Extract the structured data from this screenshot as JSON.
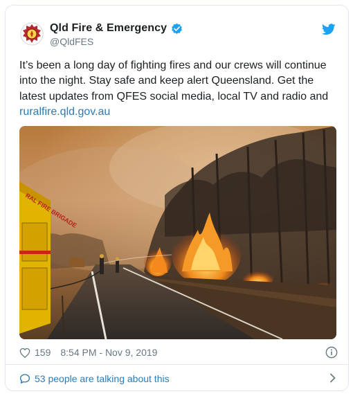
{
  "account": {
    "display_name": "Qld Fire & Emergency",
    "handle": "@QldFES",
    "verified": true
  },
  "tweet": {
    "text": "It’s been a long day of fighting fires and our crews will continue into the night. Stay safe and keep alert Queensland. Get the latest updates from QFES social media, local TV and radio and ",
    "link_text": "ruralfire.qld.gov.au"
  },
  "photo": {
    "truck_label": "RAL FIRE BRIGADE"
  },
  "meta": {
    "likes": "159",
    "timestamp": "8:54 PM - Nov 9, 2019"
  },
  "conversation": {
    "label": "53 people are talking about this"
  },
  "colors": {
    "accent": "#1da1f2",
    "link": "#2b7bb9",
    "secondary_text": "#697882"
  },
  "icons": {
    "avatar": "qfes-emblem-icon",
    "verified": "verified-badge-icon",
    "brand": "twitter-bird-icon",
    "like": "heart-icon",
    "info": "info-icon",
    "conversation": "speech-bubble-icon",
    "more": "chevron-right-icon"
  }
}
